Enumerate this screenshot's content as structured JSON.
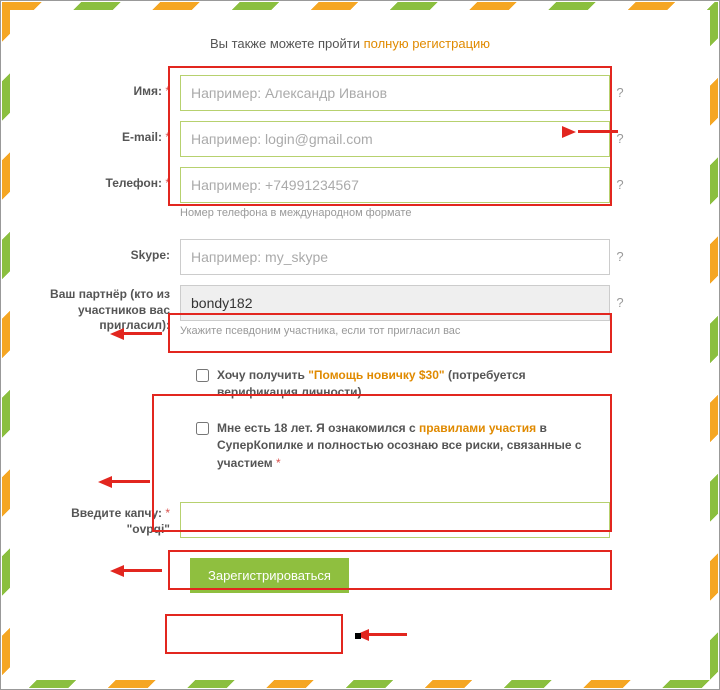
{
  "top_prefix": "Вы также можете пройти ",
  "top_link": "полную регистрацию",
  "labels": {
    "name": "Имя:",
    "email": "E-mail:",
    "phone": "Телефон:",
    "skype": "Skype:",
    "partner": "Ваш партнёр (кто из участников вас пригласил):",
    "captcha_pre": "Введите капчу:",
    "captcha_value": "\"ovpqi\""
  },
  "placeholders": {
    "name": "Например: Александр Иванов",
    "email": "Например: login@gmail.com",
    "phone": "Например: +74991234567",
    "skype": "Например: my_skype"
  },
  "values": {
    "partner": "bondy182"
  },
  "hints": {
    "phone": "Номер телефона в международном формате",
    "partner": "Укажите псевдоним участника, если тот пригласил вас"
  },
  "checks": {
    "c1_a": "Хочу получить ",
    "c1_b": "\"Помощь новичку $30\"",
    "c1_c": " (потребуется верификация личности)",
    "c2_a": "Мне есть 18 лет. Я ознакомился с ",
    "c2_b": "правилами участия",
    "c2_c": " в СуперКопилке и полностью осознаю все риски, связанные с участием ",
    "c2_req": "*"
  },
  "button": "Зарегистрироваться",
  "req": " *",
  "help": "?"
}
